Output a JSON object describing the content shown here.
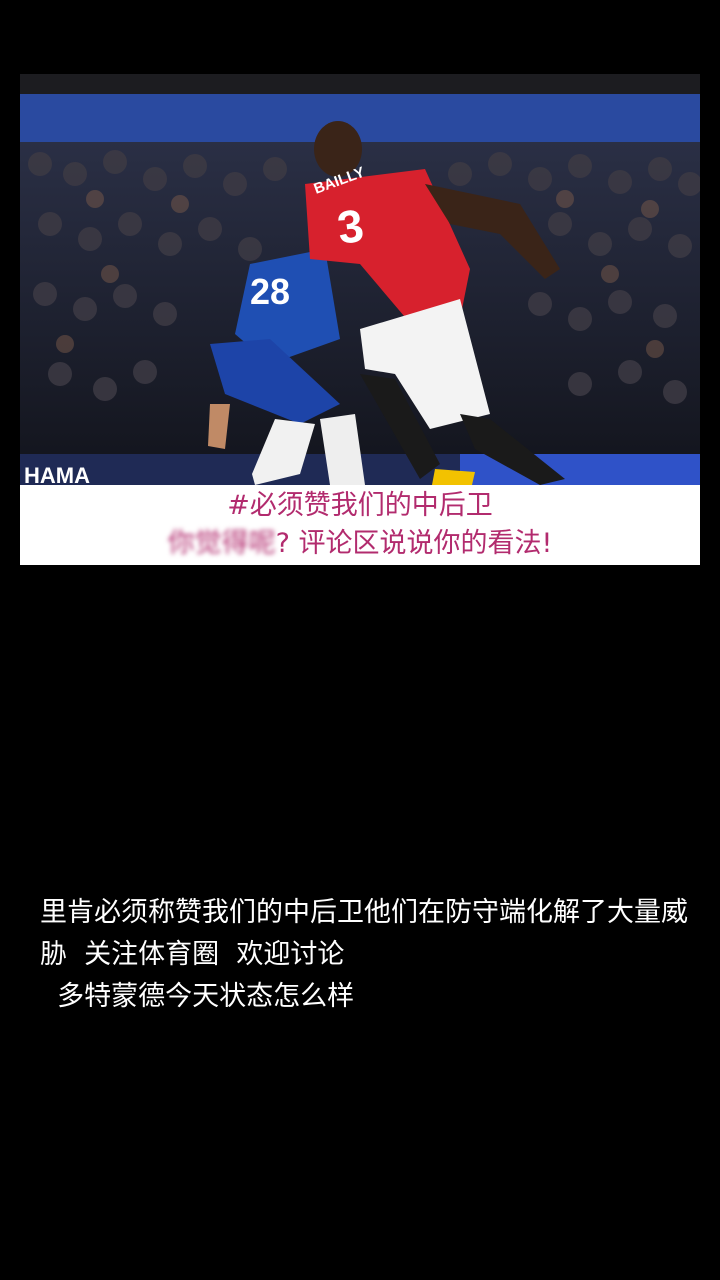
{
  "post": {
    "image": {
      "jersey_name": "BAILLY",
      "jersey_number": "3",
      "opponent_number": "28",
      "banner_text": "HAMA",
      "caption_line1": "#必须赞我们的中后卫",
      "caption_line2_blurred": "你觉得呢",
      "caption_line2": "? 评论区说说你的看法!",
      "caption_color": "#b22b6e"
    },
    "body_lines": [
      "里肯必须称赞我们的中后卫他们在防守端化解了大量威胁  关注体育圈  欢迎讨论",
      "  多特蒙德今天状态怎么样"
    ]
  }
}
